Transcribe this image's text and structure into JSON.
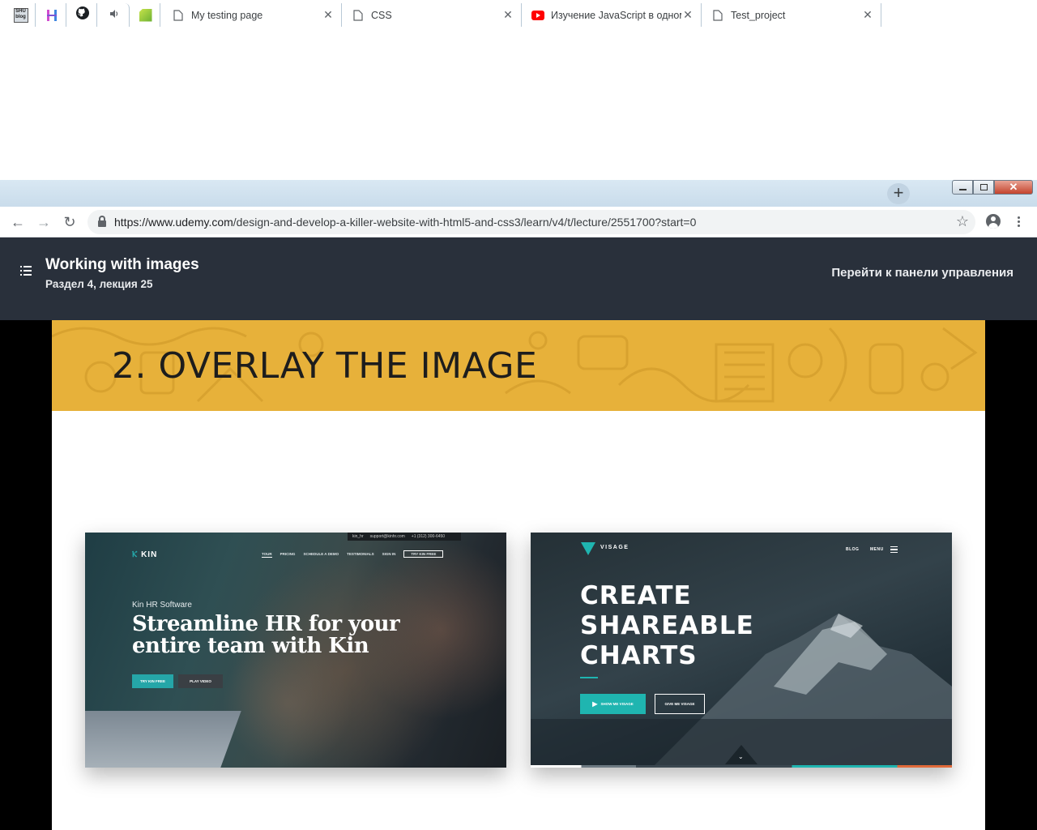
{
  "browser": {
    "pinned_tabs": [
      {
        "icon": "shu-blog-icon",
        "text": "SHU\nblog"
      },
      {
        "icon": "h-logo-icon",
        "text": "H"
      },
      {
        "icon": "github-icon",
        "text": ""
      },
      {
        "icon": "speaker-icon",
        "text": "🔈"
      },
      {
        "icon": "green-leaf-icon",
        "text": ""
      }
    ],
    "tabs": [
      {
        "title": "My testing page",
        "icon": "page-icon"
      },
      {
        "title": "CSS",
        "icon": "page-icon"
      },
      {
        "title": "Изучение JavaScript в одном",
        "icon": "youtube-icon"
      },
      {
        "title": "Test_project",
        "icon": "page-icon"
      }
    ],
    "new_tab": "+",
    "url_host": "https://www.udemy.com",
    "url_path": "/design-and-develop-a-killer-website-with-html5-and-css3/learn/v4/t/lecture/2551700?start=0",
    "colors": {
      "tabstrip": "#d0e1ee",
      "youtube": "#ff0000"
    }
  },
  "udemy": {
    "lecture_title": "Working with images",
    "lecture_subtitle": "Раздел 4, лекция 25",
    "dashboard_link": "Перейти к панели управления"
  },
  "slide": {
    "title": "2. OVERLAY THE IMAGE",
    "banner_color": "#e7b13a",
    "kin": {
      "logo": "KIN",
      "topbar": [
        "kin_hr",
        "support@kinhr.com",
        "+1 (312) 300-6450"
      ],
      "nav": [
        "TOUR",
        "PRICING",
        "SCHEDULE A DEMO",
        "TESTIMONIALS",
        "SIGN IN"
      ],
      "nav_cta": "TRY KIN FREE",
      "eyebrow": "Kin HR Software",
      "headline_1": "Streamline HR for your",
      "headline_2": "entire team with Kin",
      "btn_primary": "TRY KIN FREE",
      "btn_secondary": "PLAY VIDEO",
      "accent": "#25a6a8"
    },
    "visage": {
      "logo": "VISAGE",
      "nav": [
        "BLOG",
        "MENU"
      ],
      "headline": [
        "CREATE",
        "SHAREABLE",
        "CHARTS"
      ],
      "btn_primary": "SHOW ME VISAGE",
      "btn_secondary": "GIVE ME VISAGE",
      "accent": "#1fb5b0"
    }
  }
}
